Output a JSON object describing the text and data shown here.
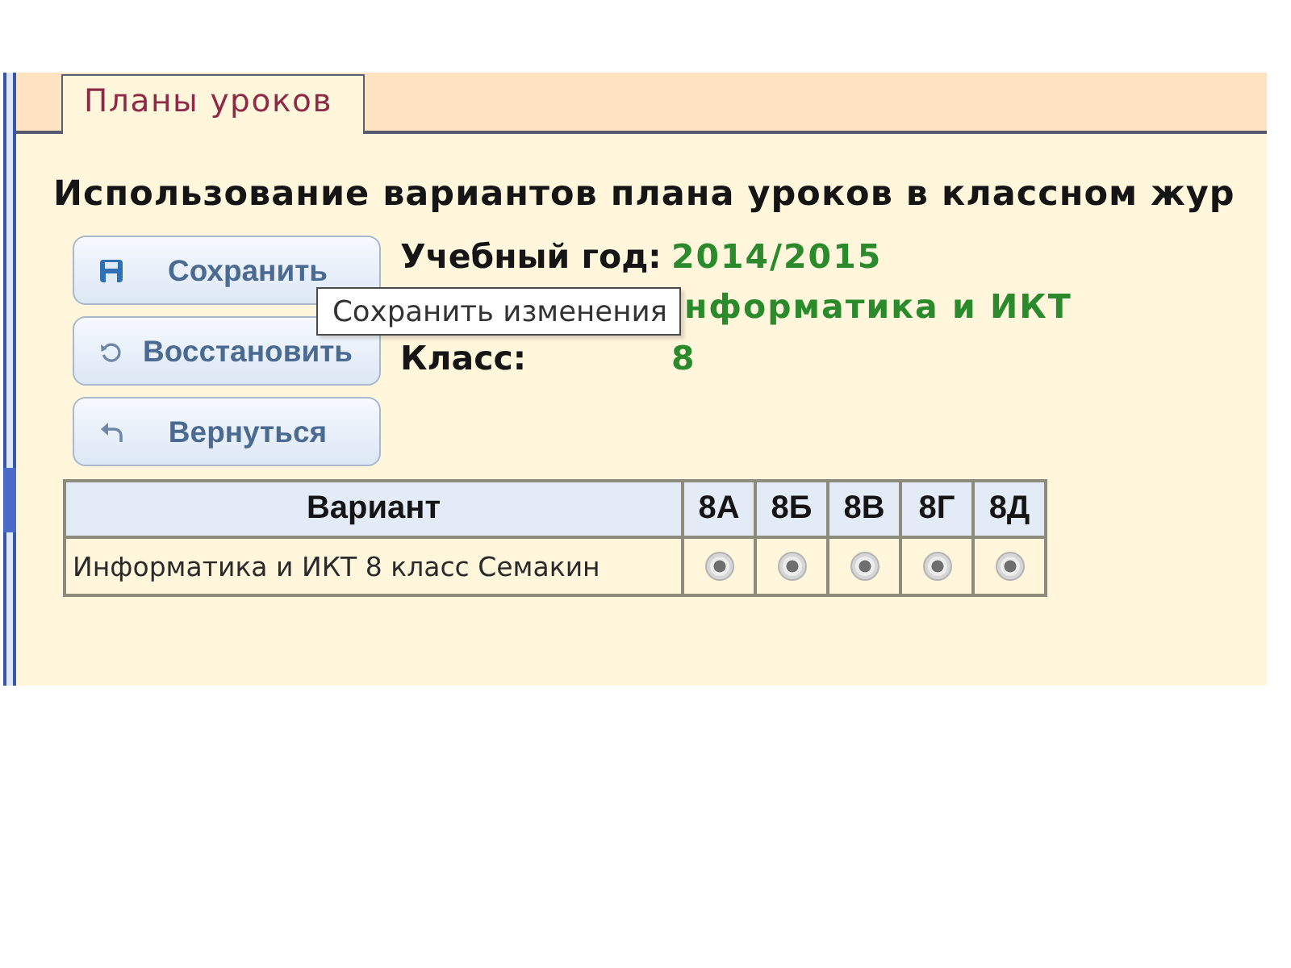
{
  "tabs": [
    {
      "label": "Планы уроков",
      "selected": true
    }
  ],
  "heading": "Использование вариантов плана уроков в классном жур",
  "buttons": [
    {
      "kind": "save",
      "label": "Сохранить"
    },
    {
      "kind": "restore",
      "label": "Восстановить"
    },
    {
      "kind": "back",
      "label": "Вернуться"
    }
  ],
  "info": [
    {
      "label": "Учебный год:",
      "value": "2014/2015"
    },
    {
      "value": "нформатика и ИКТ"
    },
    {
      "label": "Класс:",
      "value": "8"
    }
  ],
  "tooltip": {
    "text": "Сохранить изменения"
  },
  "table": {
    "columns": [
      "Вариант",
      "8А",
      "8Б",
      "8В",
      "8Г",
      "8Д"
    ],
    "rows": [
      {
        "name": "Информатика и ИКТ 8 класс Семакин",
        "cells": [
          {
            "selected": true,
            "disabled": true
          },
          {
            "selected": true,
            "disabled": true
          },
          {
            "selected": true,
            "disabled": true
          },
          {
            "selected": true,
            "disabled": true
          },
          {
            "selected": true,
            "disabled": true
          }
        ]
      }
    ]
  }
}
